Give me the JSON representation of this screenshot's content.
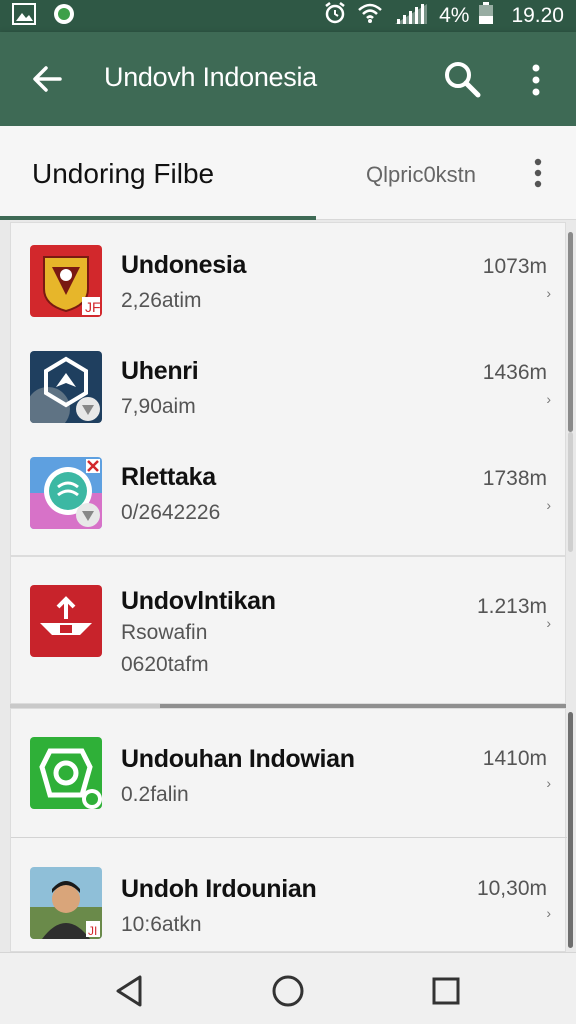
{
  "status_bar": {
    "battery_text": "4%",
    "time": "19.20",
    "icons": [
      "gallery-icon",
      "app-notification-icon",
      "alarm-icon",
      "wifi-icon",
      "signal-icon",
      "battery-icon"
    ]
  },
  "app_bar": {
    "title": "Undovh Indonesia",
    "icons": [
      "back-arrow-icon",
      "search-icon",
      "more-vert-icon"
    ]
  },
  "sub_bar": {
    "heading": "Undoring Filbe",
    "filter": "Qlpric0kstn",
    "icons": [
      "more-vert-icon"
    ]
  },
  "items": [
    {
      "name": "Undonesia",
      "sub": "2,26atim",
      "size": "1073m",
      "icon": "emblem-icon",
      "color": "#d2282c"
    },
    {
      "name": "Uhenri",
      "sub": "7,90aim",
      "size": "1436m",
      "icon": "shield-icon",
      "color": "#1f3f5f"
    },
    {
      "name": "Rlettaka",
      "sub": "0/2642226",
      "size": "1738m",
      "icon": "chat-bubble-icon",
      "color": "#3cb8a3"
    },
    {
      "name": "Undovlntikan",
      "sub": "Rsowafin",
      "sub2": "0620tafm",
      "size": "1.213m",
      "icon": "ship-icon",
      "color": "#c8232b"
    },
    {
      "name": "Undouhan Indowian",
      "sub": "0.2falin",
      "size": "1410m",
      "icon": "camera-icon",
      "color": "#2fb038"
    },
    {
      "name": "Undoh Irdounian",
      "sub": "10:6atkn",
      "size": "10,30m",
      "icon": "person-avatar-icon",
      "color": "#6a8a4a"
    }
  ],
  "nav_bar": {
    "icons": [
      "back-nav-icon",
      "home-nav-icon",
      "recents-nav-icon"
    ]
  }
}
